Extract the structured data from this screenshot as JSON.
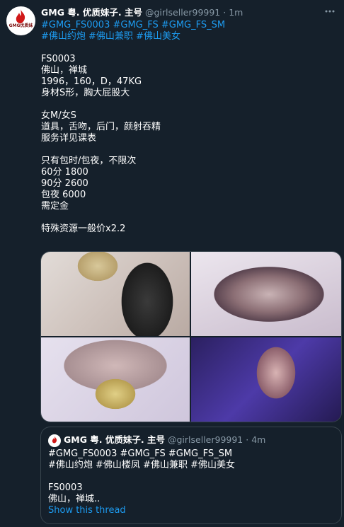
{
  "tweet": {
    "display_name": "GMG 粤. 优质妹子. 主号",
    "handle": "@girlseller99991",
    "separator": "·",
    "time": "1m",
    "avatar_label": "GMG优质妹",
    "hashtags_line1": "#GMG_FS0003 #GMG_FS #GMG_FS_SM",
    "hashtags_line2": "#佛山约炮 #佛山兼职 #佛山美女",
    "lines": [
      "FS0003",
      "佛山，禅城",
      "1996，160，D，47KG",
      "身材S形，胸大屁股大",
      "",
      "女M/女S",
      "道具，舌吻，后门，颜射吞精",
      "服务详见课表",
      "",
      "只有包时/包夜，不限次",
      "60分 1800",
      "90分 2600",
      "包夜 6000",
      "需定金",
      "",
      "特殊资源一般价x2.2"
    ]
  },
  "quoted": {
    "display_name": "GMG 粤. 优质妹子. 主号",
    "handle": "@girlseller99991",
    "separator": "·",
    "time": "4m",
    "hashtags_line1": "#GMG_FS0003 #GMG_FS #GMG_FS_SM",
    "hashtags_line2": "#佛山约炮 #佛山楼凤 #佛山兼职 #佛山美女",
    "line1": "FS0003",
    "line2": "佛山，禅城..",
    "show_thread": "Show this thread"
  },
  "colors": {
    "background": "#15202b",
    "link": "#1d9bf0",
    "secondary": "#8899a6",
    "border": "#38444d"
  }
}
